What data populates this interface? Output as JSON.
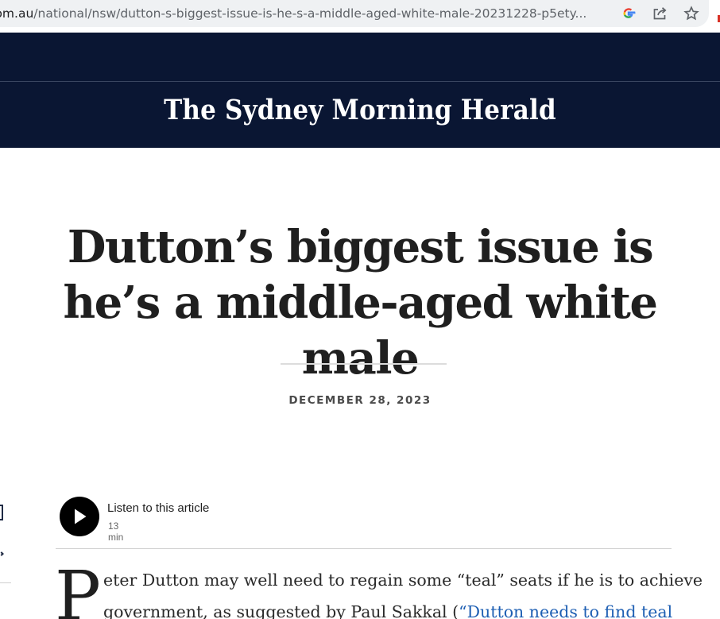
{
  "browser": {
    "url_host": ".com.au",
    "url_path": "/national/nsw/dutton-s-biggest-issue-is-he-s-a-middle-aged-white-male-20231228-p5ety...",
    "icons": [
      "google-icon",
      "share-icon",
      "star-icon"
    ]
  },
  "site": {
    "name": "The Sydney Morning Herald"
  },
  "article": {
    "headline": "Dutton’s biggest issue is he’s a middle-aged white male",
    "date": "DECEMBER 28, 2023",
    "audio": {
      "label": "Listen to this article",
      "duration": "13 min"
    },
    "dropcap": "P",
    "line1": "eter Dutton may well need to regain some “teal” seats if he is to achieve",
    "line2_text": "government, as suggested by Paul Sakkal (",
    "line2_link": "“Dutton needs to find teal"
  },
  "colors": {
    "masthead": "#0a1633",
    "link": "#1e5fb3",
    "text": "#1f1f1f"
  }
}
